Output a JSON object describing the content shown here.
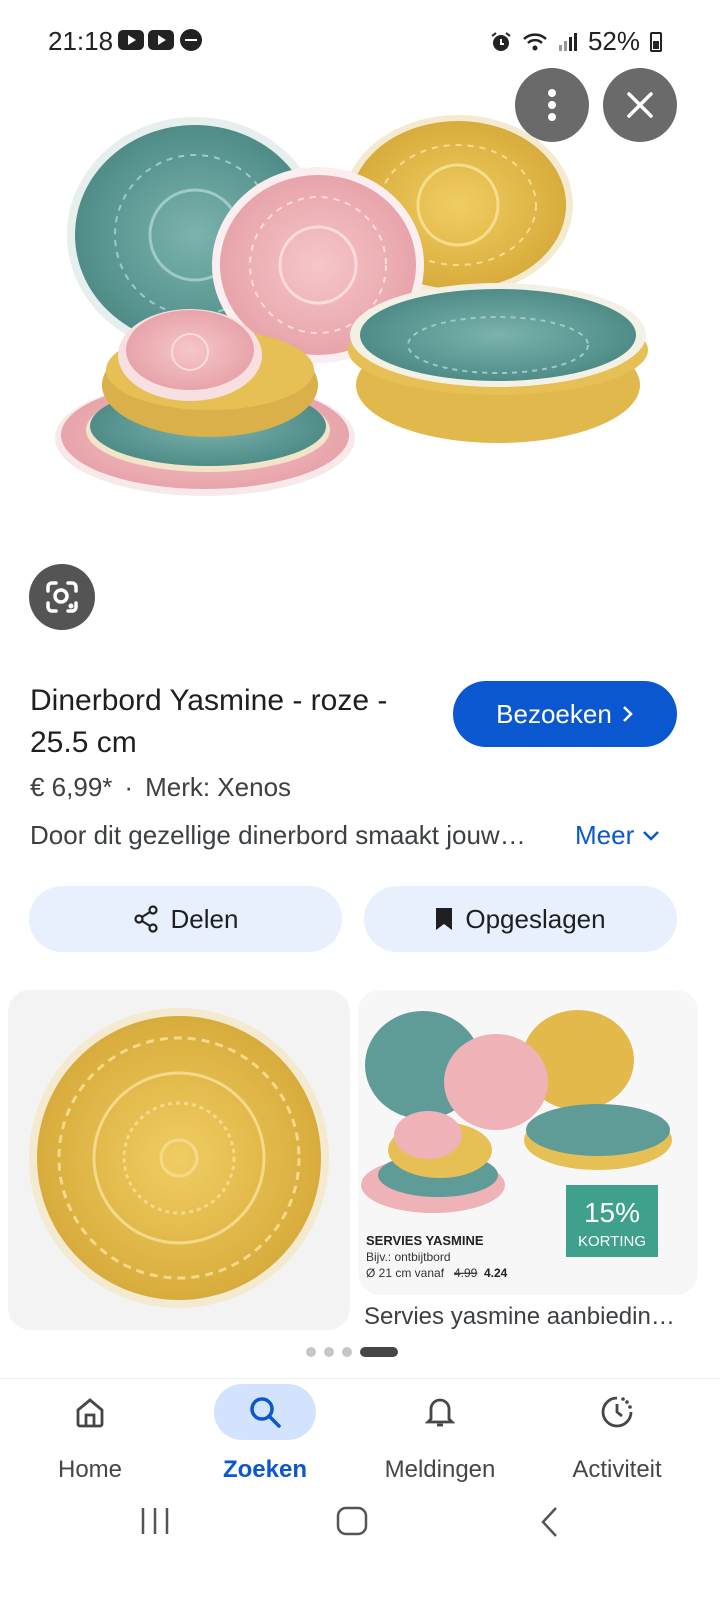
{
  "status_bar": {
    "time": "21:18",
    "battery": "52%",
    "icons": [
      "youtube-icon",
      "youtube-icon",
      "do-not-disturb-icon",
      "alarm-icon",
      "wifi-icon",
      "signal-icon",
      "battery-icon"
    ]
  },
  "top_actions": {
    "more_icon": "more-vert-icon",
    "close_icon": "close-icon"
  },
  "product": {
    "title": "Dinerbord Yasmine - roze - 25.5 cm",
    "visit_label": "Bezoeken",
    "price": "€ 6,99*",
    "separator": "·",
    "brand": "Merk: Xenos",
    "description": "Door dit gezellige dinerbord smaakt jouw…",
    "more_label": "Meer"
  },
  "actions": {
    "share_label": "Delen",
    "saved_label": "Opgeslagen"
  },
  "related": {
    "card2": {
      "heading": "SERVIES YASMINE",
      "sub1": "Bijv.: ontbijtbord",
      "sub2": "Ø 21 cm vanaf",
      "old_price": "4.99",
      "new_price": "4.24",
      "badge_pct": "15%",
      "badge_text": "KORTING"
    },
    "caption": "Servies yasmine aanbiedin…"
  },
  "colors": {
    "accent": "#0b57d0",
    "pill_bg": "#e8f0fe",
    "teal_plate": "#5f9c98",
    "pink_plate": "#eeb2b7",
    "yellow_plate": "#e3b94c",
    "badge": "#3fa08c"
  },
  "bottom_nav": [
    {
      "label": "Home",
      "icon": "home-icon"
    },
    {
      "label": "Zoeken",
      "icon": "search-icon"
    },
    {
      "label": "Meldingen",
      "icon": "bell-icon"
    },
    {
      "label": "Activiteit",
      "icon": "activity-icon"
    }
  ]
}
